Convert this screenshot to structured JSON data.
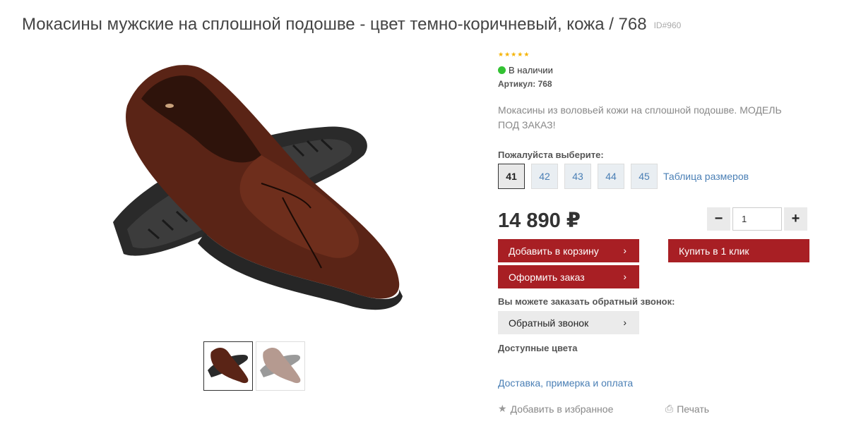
{
  "product": {
    "title": "Мокасины мужские на сплошной подошве - цвет темно-коричневый, кожа / 768",
    "id_label": "ID#960",
    "rating_stars": 5,
    "stock_text": "В наличии",
    "sku_text": "Артикул: 768",
    "description": "Мокасины из воловьей кожи на сплошной подошве. МОДЕЛЬ ПОД ЗАКАЗ!",
    "price": "14 890 ₽"
  },
  "sizes": {
    "label": "Пожалуйста выберите:",
    "options": [
      "41",
      "42",
      "43",
      "44",
      "45"
    ],
    "selected": "41",
    "table_link": "Таблица размеров"
  },
  "quantity": {
    "minus": "−",
    "value": "1",
    "plus": "+"
  },
  "buttons": {
    "add_to_cart": "Добавить в корзину",
    "checkout": "Оформить заказ",
    "buy_one_click": "Купить в 1 клик",
    "arrow": "›"
  },
  "callback": {
    "label": "Вы можете заказать обратный звонок:",
    "button": "Обратный звонок"
  },
  "colors_label": "Доступные цвета",
  "delivery_link": "Доставка, примерка и оплата",
  "actions": {
    "favorite": "Добавить в избранное",
    "print": "Печать"
  },
  "colors": {
    "accent_red": "#a81f24",
    "link_blue": "#4a7fb5",
    "stock_green": "#33c233",
    "star": "#f5b301"
  }
}
